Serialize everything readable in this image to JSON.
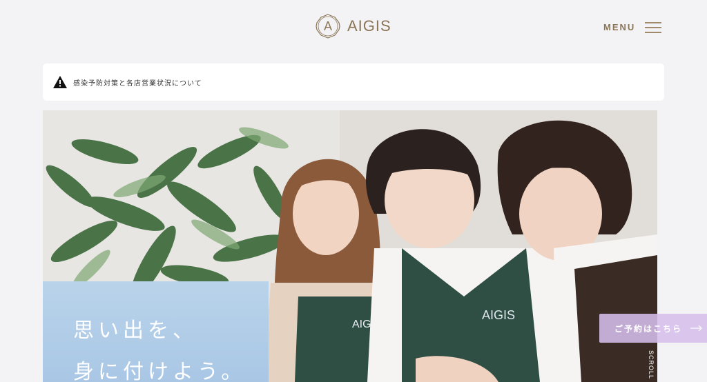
{
  "header": {
    "logo_letter": "A",
    "logo_text": "AIGIS",
    "menu_label": "MENU"
  },
  "notice": {
    "icon": "warning-icon",
    "text": "感染予防対策と各店営業状況について"
  },
  "hero": {
    "copy_lines": [
      "思い出を、",
      "身に付けよう。"
    ],
    "apron_brand": "AIGIS"
  },
  "reserve": {
    "label": "ご予約はこちら",
    "icon": "arrow-right-icon"
  },
  "scroll_label": "SCROLL",
  "colors": {
    "brand_gold": "#8a7556",
    "copy_box_blue": "#b0cde8",
    "reserve_lavender": "#d6beec",
    "apron_green": "#2f4f45",
    "background": "#f3f3f5"
  }
}
